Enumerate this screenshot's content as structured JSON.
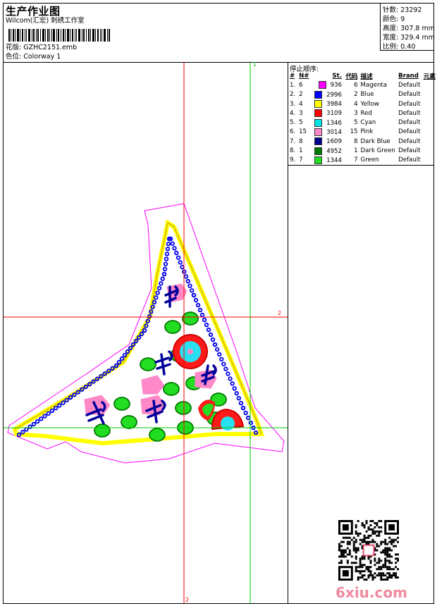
{
  "header": {
    "title": "生产作业图",
    "company": "Wilcom(汇宏) 刺绣工作室",
    "design_file_label": "花版:",
    "design_file": "GZHC2151.emb",
    "colorway_label": "色位:",
    "colorway": "Colorway 1"
  },
  "stats": {
    "stitches_label": "针数:",
    "stitches": "23292",
    "colors_label": "颜色:",
    "colors": "9",
    "height_label": "高度:",
    "height": "307.8 mm",
    "width_label": "宽度:",
    "width": "329.4 mm",
    "scale_label": "比例:",
    "scale": "0.40"
  },
  "legend": {
    "title": "停止顺序:",
    "headers": {
      "idx": "#",
      "no": "N#",
      "st": "St.",
      "code": "代码",
      "desc": "描述",
      "brand": "Brand",
      "el": "元素"
    },
    "rows": [
      {
        "idx": "1.",
        "no": "6",
        "color": "#ff00ff",
        "st": "936",
        "code": "6",
        "desc": "Magenta",
        "brand": "Default"
      },
      {
        "idx": "2.",
        "no": "2",
        "color": "#0000ff",
        "st": "2996",
        "code": "2",
        "desc": "Blue",
        "brand": "Default"
      },
      {
        "idx": "3.",
        "no": "4",
        "color": "#ffff00",
        "st": "3984",
        "code": "4",
        "desc": "Yellow",
        "brand": "Default"
      },
      {
        "idx": "4.",
        "no": "3",
        "color": "#ff0000",
        "st": "3109",
        "code": "3",
        "desc": "Red",
        "brand": "Default"
      },
      {
        "idx": "5.",
        "no": "5",
        "color": "#00e5e5",
        "st": "1346",
        "code": "5",
        "desc": "Cyan",
        "brand": "Default"
      },
      {
        "idx": "6.",
        "no": "15",
        "color": "#ff88c8",
        "st": "3014",
        "code": "15",
        "desc": "Pink",
        "brand": "Default"
      },
      {
        "idx": "7.",
        "no": "8",
        "color": "#000090",
        "st": "1609",
        "code": "8",
        "desc": "Dark Blue",
        "brand": "Default"
      },
      {
        "idx": "8.",
        "no": "1",
        "color": "#007a00",
        "st": "4952",
        "code": "1",
        "desc": "Dark Green",
        "brand": "Default"
      },
      {
        "idx": "9.",
        "no": "7",
        "color": "#22dd22",
        "st": "1344",
        "code": "7",
        "desc": "Green",
        "brand": "Default"
      }
    ]
  },
  "guides": {
    "vertical_1": "1",
    "horizontal_2": "2",
    "bottom_2": "2"
  },
  "watermark": "6xiu.com"
}
